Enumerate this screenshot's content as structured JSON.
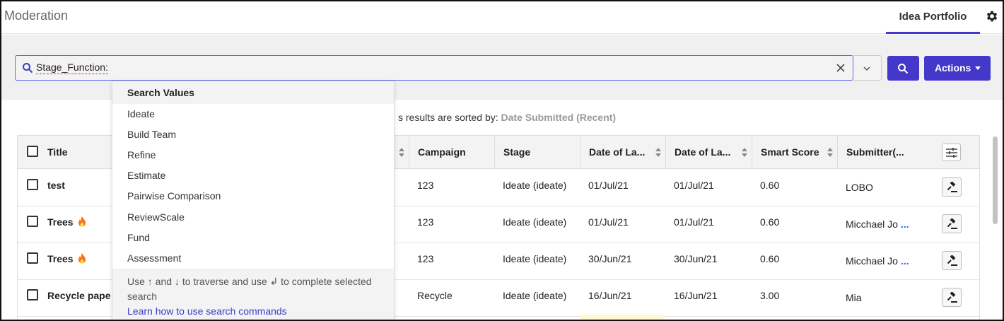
{
  "header": {
    "app_title": "Moderation",
    "tab_label": "Idea Portfolio",
    "gear_icon": "gear-icon"
  },
  "search": {
    "value": "Stage_Function:",
    "search_icon": "search-icon",
    "clear_icon": "close-icon",
    "toggle_icon": "chevron-down-icon",
    "actions_label": "Actions"
  },
  "sort": {
    "prefix": "s results are sorted by: ",
    "value": "Date Submitted (Recent)"
  },
  "dropdown": {
    "header": "Search Values",
    "items": [
      "Ideate",
      "Build Team",
      "Refine",
      "Estimate",
      "Pairwise Comparison",
      "ReviewScale",
      "Fund",
      "Assessment"
    ],
    "hint_prefix": "Use ↑ and ↓ to traverse and use ",
    "hint_suffix": " to complete selected search",
    "enter_glyph": "↲",
    "link": "Learn how to use search commands"
  },
  "table": {
    "columns": [
      "Title",
      "Campaign",
      "Stage",
      "Date of La...",
      "Date of La...",
      "Smart Score",
      "Submitter(..."
    ],
    "rows": [
      {
        "title": "test",
        "campaign": "123",
        "stage": "Ideate (ideate)",
        "date1": "01/Jul/21",
        "date2": "01/Jul/21",
        "score": "0.60",
        "submitter": "LOBO",
        "more": "",
        "fire": false
      },
      {
        "title": "Trees",
        "campaign": "123",
        "stage": "Ideate (ideate)",
        "date1": "01/Jul/21",
        "date2": "01/Jul/21",
        "score": "0.60",
        "submitter": "Micchael Jo",
        "more": "...",
        "fire": true
      },
      {
        "title": "Trees",
        "campaign": "123",
        "stage": "Ideate (ideate)",
        "date1": "30/Jun/21",
        "date2": "30/Jun/21",
        "score": "0.60",
        "submitter": "Micchael Jo",
        "more": "...",
        "fire": true
      },
      {
        "title": "Recycle pape",
        "campaign": "Recycle",
        "stage": "Ideate (ideate)",
        "date1": "16/Jun/21",
        "date2": "16/Jun/21",
        "score": "3.00",
        "submitter": "Mia",
        "more": "",
        "fire": false
      }
    ]
  },
  "colors": {
    "accent": "#4338ca",
    "link": "#3b3bc9"
  }
}
